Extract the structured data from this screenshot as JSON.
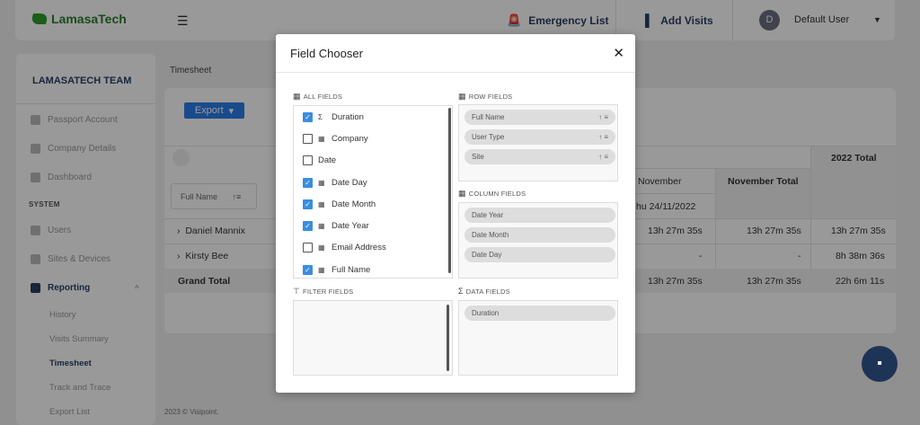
{
  "topbar": {
    "brand": "LamasaTech",
    "emergency_list": "Emergency List",
    "add_visits": "Add Visits",
    "avatar_initial": "D",
    "user_name": "Default User"
  },
  "sidebar": {
    "team": "LAMASATECH TEAM",
    "items": [
      {
        "label": "Passport Account",
        "icon": "passport-icon"
      },
      {
        "label": "Company Details",
        "icon": "building-icon"
      },
      {
        "label": "Dashboard",
        "icon": "home-icon"
      }
    ],
    "section_system": "SYSTEM",
    "system_items": [
      {
        "label": "Users",
        "icon": "users-icon"
      },
      {
        "label": "Sites & Devices",
        "icon": "devices-icon"
      },
      {
        "label": "Reporting",
        "icon": "chart-icon"
      }
    ],
    "reporting_sub": [
      "History",
      "Visits Summary",
      "Timesheet",
      "Track and Trace",
      "Export List"
    ]
  },
  "main": {
    "breadcrumb": "Timesheet",
    "export_label": "Export",
    "full_name_filter": "Full Name",
    "col_november": "November",
    "col_november_total": "November Total",
    "col_2022_total": "2022 Total",
    "col_date_partial": "hu 24/11/2022",
    "rows": [
      {
        "name": "Daniel Mannix",
        "november": "13h 27m 35s",
        "november_total": "13h 27m 35s",
        "total_2022": "13h 27m 35s"
      },
      {
        "name": "Kirsty Bee",
        "november": "-",
        "november_total": "-",
        "total_2022": "8h 38m 36s"
      }
    ],
    "grand_total": {
      "label": "Grand Total",
      "november": "13h 27m 35s",
      "november_total": "13h 27m 35s",
      "total_2022": "22h 6m 11s"
    },
    "footer": "2023 © Visipoint."
  },
  "modal": {
    "title": "Field Chooser",
    "all_fields_header": "ALL FIELDS",
    "row_fields_header": "ROW FIELDS",
    "column_fields_header": "COLUMN FIELDS",
    "filter_fields_header": "FILTER FIELDS",
    "data_fields_header": "DATA FIELDS",
    "all_fields": [
      {
        "label": "Duration",
        "checked": true,
        "kind": "sigma"
      },
      {
        "label": "Company",
        "checked": false,
        "kind": "grid"
      },
      {
        "label": "Date",
        "checked": false,
        "kind": "none"
      },
      {
        "label": "Date Day",
        "checked": true,
        "kind": "grid"
      },
      {
        "label": "Date Month",
        "checked": true,
        "kind": "grid"
      },
      {
        "label": "Date Year",
        "checked": true,
        "kind": "grid"
      },
      {
        "label": "Email Address",
        "checked": false,
        "kind": "grid"
      },
      {
        "label": "Full Name",
        "checked": true,
        "kind": "grid"
      }
    ],
    "row_fields": [
      "Full Name",
      "User Type",
      "Site"
    ],
    "column_fields": [
      "Date Year",
      "Date Month",
      "Date Day"
    ],
    "data_fields": [
      "Duration"
    ]
  }
}
